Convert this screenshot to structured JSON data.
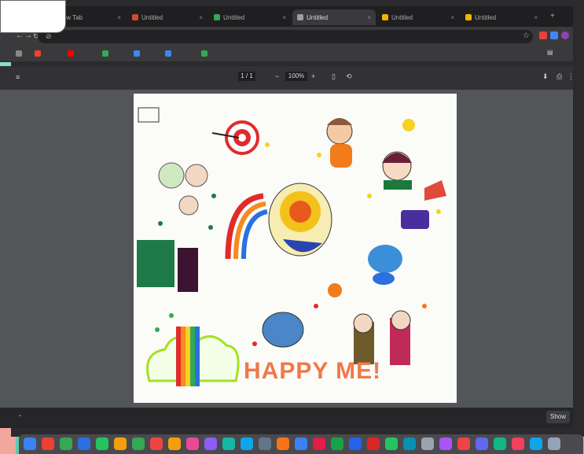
{
  "browser": {
    "tabs": [
      {
        "title": "New Tab",
        "color": "#e04a3b"
      },
      {
        "title": "Untitled",
        "color": "#d14836"
      },
      {
        "title": "Untitled",
        "color": "#34a853"
      },
      {
        "title": "Untitled",
        "color": "#9aa0a6",
        "active": true
      },
      {
        "title": "Untitled",
        "color": "#f4b400"
      },
      {
        "title": "Untitled",
        "color": "#f4b400"
      }
    ],
    "bookmarks": [
      "",
      "",
      "",
      "",
      "",
      "",
      ""
    ],
    "url": ""
  },
  "pdf": {
    "title": "",
    "page_box": "1 / 1",
    "zoom": "100%"
  },
  "download": {
    "item": "",
    "show_all": "Show"
  },
  "drawing": {
    "title": "HAPPY ME!"
  },
  "colors": {
    "accent": "#e8592b",
    "teal": "#7fd8c6",
    "viewer": "#525659"
  },
  "icons": [
    "back-icon",
    "forward-icon",
    "reload-icon",
    "star-icon",
    "download-icon",
    "print-icon",
    "menu-icon"
  ]
}
